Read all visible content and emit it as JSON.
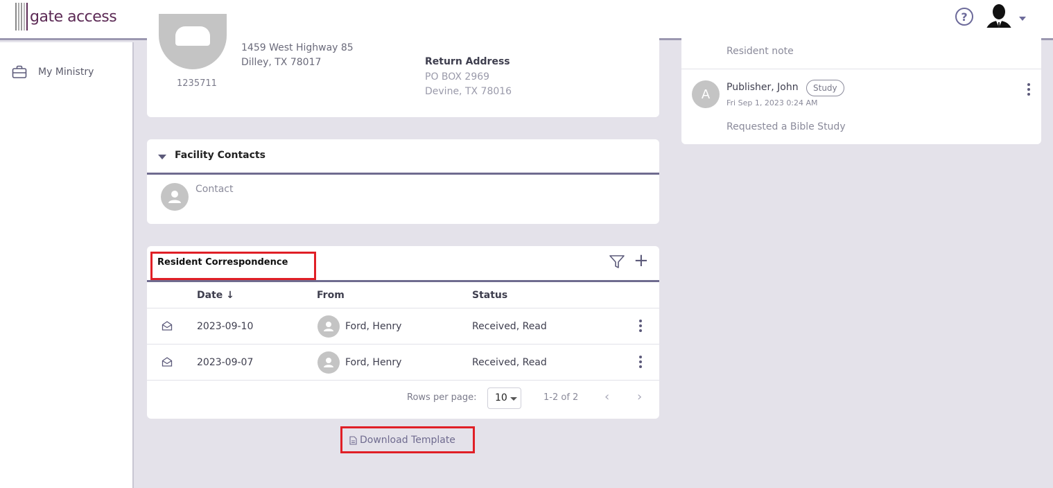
{
  "app": {
    "logo_text": "gate access"
  },
  "header": {
    "help_icon": "help-circle-icon",
    "avatar_icon": "user-avatar-icon"
  },
  "sidebar": {
    "items": [
      {
        "label": "My Ministry",
        "icon": "briefcase-icon"
      }
    ]
  },
  "resident": {
    "id": "1235711",
    "address_line1": "1459 West Highway 85",
    "address_line2": "Dilley, TX 78017",
    "return_label": "Return Address",
    "return_line1": "PO BOX 2969",
    "return_line2": "Devine, TX 78016"
  },
  "facility_contacts": {
    "title": "Facility Contacts",
    "contact_label": "Contact"
  },
  "correspondence": {
    "title": "Resident Correspondence",
    "columns": {
      "date": "Date",
      "from": "From",
      "status": "Status"
    },
    "rows": [
      {
        "date": "2023-09-10",
        "from": "Ford, Henry",
        "status": "Received, Read"
      },
      {
        "date": "2023-09-07",
        "from": "Ford, Henry",
        "status": "Received, Read"
      }
    ],
    "rows_per_page_label": "Rows per page:",
    "rows_per_page": "10",
    "range": "1-2 of 2",
    "download_label": "Download Template"
  },
  "notes": {
    "first_text": "Resident note",
    "second": {
      "avatar_letter": "A",
      "name": "Publisher, John",
      "badge": "Study",
      "date": "Fri Sep 1, 2023 0:24 AM",
      "text": "Requested a Bible Study"
    }
  },
  "colors": {
    "accent": "#6f6b8f",
    "highlight_box": "#e01f26",
    "logo": "#5c2a55",
    "background": "#e4e2ea"
  }
}
